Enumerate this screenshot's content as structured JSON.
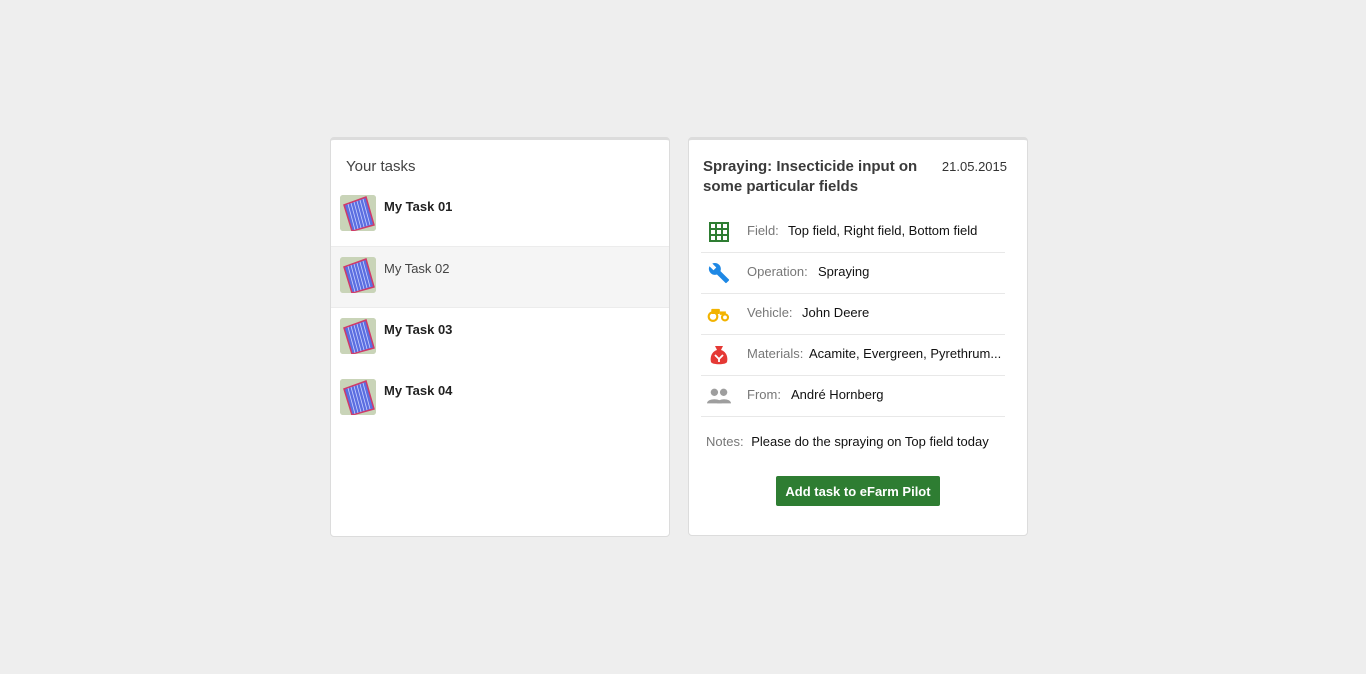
{
  "tasks_panel": {
    "title": "Your tasks",
    "tasks": [
      {
        "name": "My Task 01",
        "selected": false
      },
      {
        "name": "My Task 02",
        "selected": true
      },
      {
        "name": "My Task 03",
        "selected": false
      },
      {
        "name": "My Task 04",
        "selected": false
      }
    ]
  },
  "detail": {
    "title": "Spraying: Insecticide input on some particular fields",
    "date": "21.05.2015",
    "rows": [
      {
        "icon": "grid-icon",
        "label": "Field:",
        "value": "Top field, Right field, Bottom field",
        "color": "#2e7d32"
      },
      {
        "icon": "wrench-icon",
        "label": "Operation:",
        "value": "Spraying",
        "color": "#1e88e5"
      },
      {
        "icon": "tractor-icon",
        "label": "Vehicle:",
        "value": "John Deere",
        "color": "#f2b300"
      },
      {
        "icon": "sack-icon",
        "label": "Materials:",
        "value": "Acamite, Evergreen, Pyrethrum...",
        "color": "#e53935"
      },
      {
        "icon": "people-icon",
        "label": "From:",
        "value": "André Hornberg",
        "color": "#9e9e9e"
      }
    ],
    "notes_label": "Notes:",
    "notes_value": "Please do the spraying on Top field today",
    "button_label": "Add task to eFarm Pilot"
  }
}
